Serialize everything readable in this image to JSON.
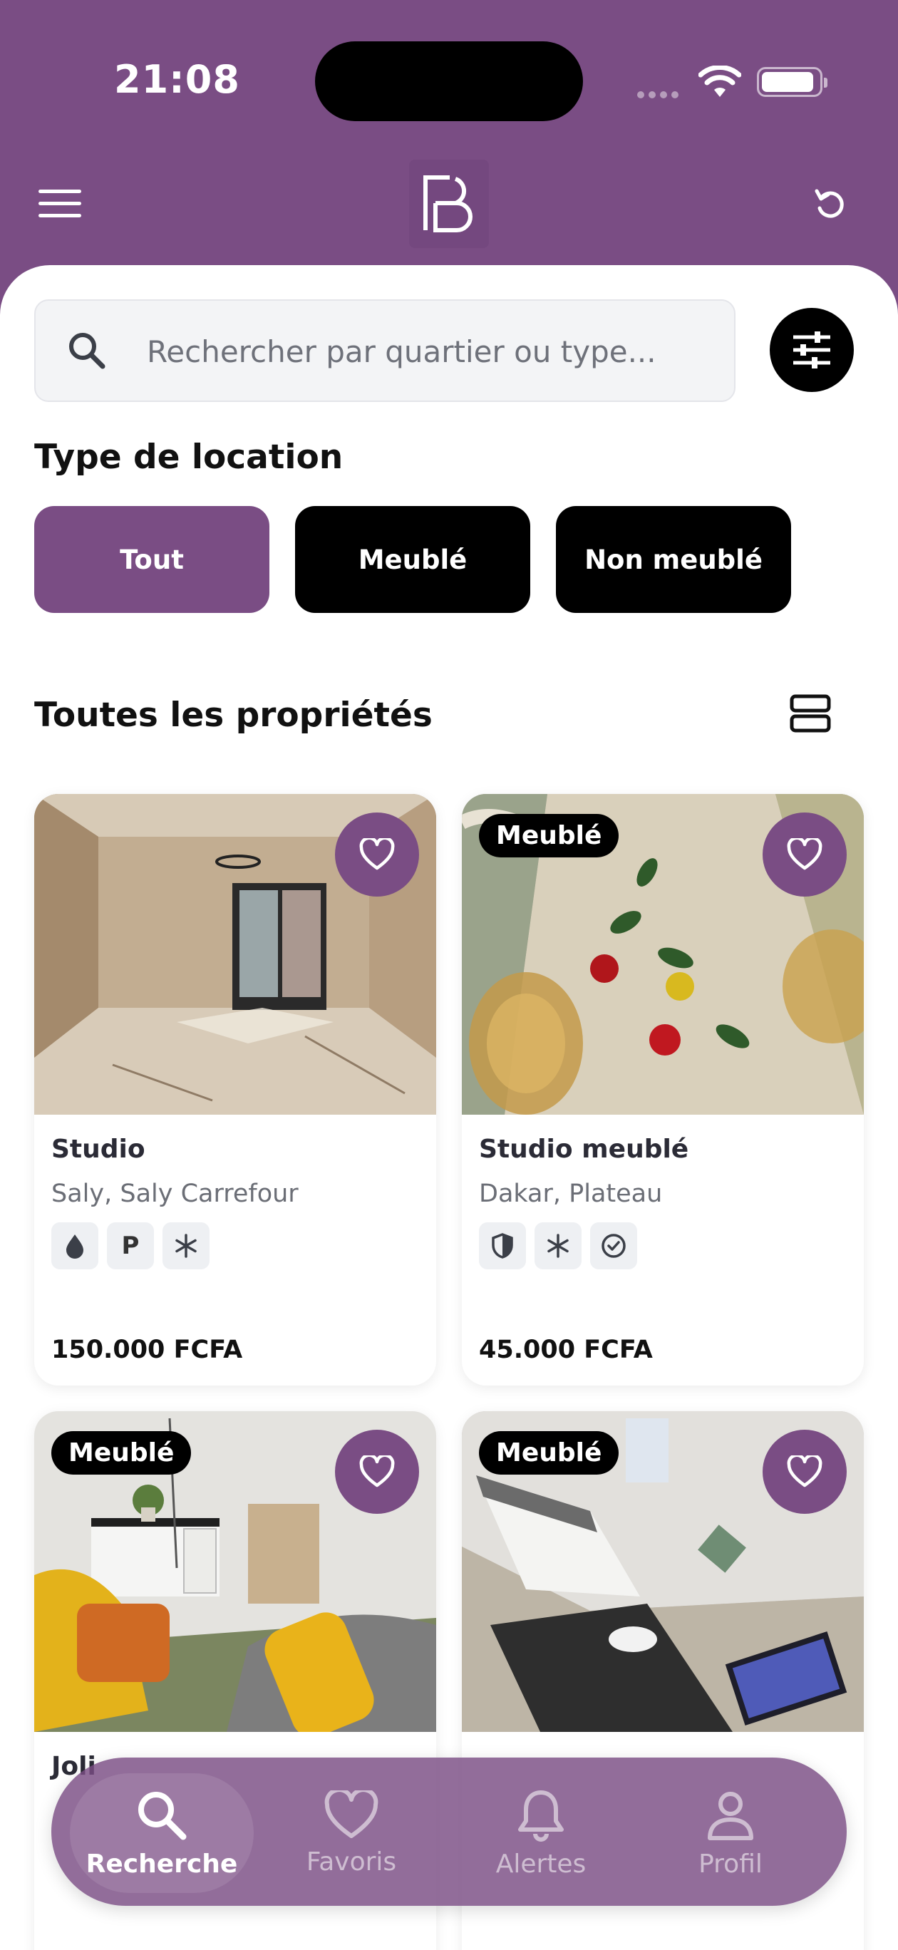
{
  "status_bar": {
    "time": "21:08"
  },
  "search": {
    "placeholder": "Rechercher par quartier ou type..."
  },
  "rental_type": {
    "title": "Type de location",
    "chips": [
      {
        "label": "Tout",
        "active": true
      },
      {
        "label": "Meublé",
        "active": false
      },
      {
        "label": "Non meublé",
        "active": false
      }
    ]
  },
  "properties": {
    "title": "Toutes les propriétés",
    "items": [
      {
        "title": "Studio",
        "location": "Saly, Saly Carrefour",
        "price": "150.000 FCFA",
        "badge": "",
        "amenities": [
          "water-drop-icon",
          "parking-icon",
          "air-conditioning-icon"
        ]
      },
      {
        "title": "Studio meublé",
        "location": "Dakar, Plateau",
        "price": "45.000 FCFA",
        "badge": "Meublé",
        "amenities": [
          "security-shield-icon",
          "air-conditioning-icon",
          "verified-check-icon"
        ]
      },
      {
        "title": "Joli",
        "location": "",
        "price": "",
        "badge": "Meublé",
        "amenities": []
      },
      {
        "title": "",
        "location": "",
        "price": "",
        "badge": "Meublé",
        "amenities": []
      }
    ]
  },
  "amenity_labels": {
    "parking": "P"
  },
  "nav": {
    "items": [
      {
        "label": "Recherche",
        "active": true
      },
      {
        "label": "Favoris",
        "active": false
      },
      {
        "label": "Alertes",
        "active": false
      },
      {
        "label": "Profil",
        "active": false
      }
    ]
  },
  "colors": {
    "primary": "#7a4d84",
    "dark": "#000000",
    "surface": "#ffffff"
  }
}
